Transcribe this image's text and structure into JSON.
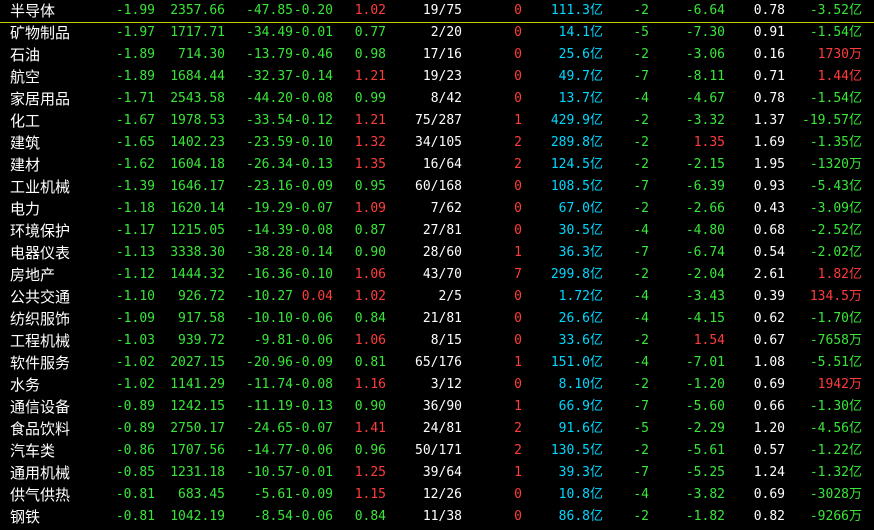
{
  "colors": {
    "up": "#ff3c3c",
    "down": "#39e639",
    "neutral": "#ffffff",
    "amount": "#00d8ff",
    "background": "#000000",
    "selection_line": "#c8c800"
  },
  "rows": [
    {
      "name": "半导体",
      "chg": "-1.99",
      "val": "2357.66",
      "amt": "-47.85",
      "ratio": "-0.20",
      "n1": "1.02",
      "n1c": "rd",
      "n2": "19/75",
      "n3": "0",
      "n3c": "rd",
      "n4": "111.3",
      "n4u": "亿",
      "n5": "-2",
      "n6": "-6.64",
      "n6c": "g",
      "n7": "0.78",
      "n8": "-3.52",
      "n8u": "亿",
      "n8c": "g"
    },
    {
      "name": "矿物制品",
      "chg": "-1.97",
      "val": "1717.71",
      "amt": "-34.49",
      "ratio": "-0.01",
      "n1": "0.77",
      "n1c": "g",
      "n2": "2/20",
      "n3": "0",
      "n3c": "rd",
      "n4": "14.1",
      "n4u": "亿",
      "n5": "-5",
      "n6": "-7.30",
      "n6c": "g",
      "n7": "0.91",
      "n8": "-1.54",
      "n8u": "亿",
      "n8c": "g"
    },
    {
      "name": "石油",
      "chg": "-1.89",
      "val": "714.30",
      "amt": "-13.79",
      "ratio": "-0.46",
      "n1": "0.98",
      "n1c": "g",
      "n2": "17/16",
      "n3": "0",
      "n3c": "rd",
      "n4": "25.6",
      "n4u": "亿",
      "n5": "-2",
      "n6": "-3.06",
      "n6c": "g",
      "n7": "0.16",
      "n8": "1730",
      "n8u": "万",
      "n8c": "rd"
    },
    {
      "name": "航空",
      "chg": "-1.89",
      "val": "1684.44",
      "amt": "-32.37",
      "ratio": "-0.14",
      "n1": "1.21",
      "n1c": "rd",
      "n2": "19/23",
      "n3": "0",
      "n3c": "rd",
      "n4": "49.7",
      "n4u": "亿",
      "n5": "-7",
      "n6": "-8.11",
      "n6c": "g",
      "n7": "0.71",
      "n8": "1.44",
      "n8u": "亿",
      "n8c": "rd"
    },
    {
      "name": "家居用品",
      "chg": "-1.71",
      "val": "2543.58",
      "amt": "-44.20",
      "ratio": "-0.08",
      "n1": "0.99",
      "n1c": "g",
      "n2": "8/42",
      "n3": "0",
      "n3c": "rd",
      "n4": "13.7",
      "n4u": "亿",
      "n5": "-4",
      "n6": "-4.67",
      "n6c": "g",
      "n7": "0.78",
      "n8": "-1.54",
      "n8u": "亿",
      "n8c": "g"
    },
    {
      "name": "化工",
      "chg": "-1.67",
      "val": "1978.53",
      "amt": "-33.54",
      "ratio": "-0.12",
      "n1": "1.21",
      "n1c": "rd",
      "n2": "75/287",
      "n3": "1",
      "n3c": "rd",
      "n4": "429.9",
      "n4u": "亿",
      "n5": "-2",
      "n6": "-3.32",
      "n6c": "g",
      "n7": "1.37",
      "n8": "-19.57",
      "n8u": "亿",
      "n8c": "g"
    },
    {
      "name": "建筑",
      "chg": "-1.65",
      "val": "1402.23",
      "amt": "-23.59",
      "ratio": "-0.10",
      "n1": "1.32",
      "n1c": "rd",
      "n2": "34/105",
      "n3": "2",
      "n3c": "rd",
      "n4": "289.8",
      "n4u": "亿",
      "n5": "-2",
      "n6": "1.35",
      "n6c": "rd",
      "n7": "1.69",
      "n8": "-1.35",
      "n8u": "亿",
      "n8c": "g"
    },
    {
      "name": "建材",
      "chg": "-1.62",
      "val": "1604.18",
      "amt": "-26.34",
      "ratio": "-0.13",
      "n1": "1.35",
      "n1c": "rd",
      "n2": "16/64",
      "n3": "2",
      "n3c": "rd",
      "n4": "124.5",
      "n4u": "亿",
      "n5": "-2",
      "n6": "-2.15",
      "n6c": "g",
      "n7": "1.95",
      "n8": "-1320",
      "n8u": "万",
      "n8c": "g"
    },
    {
      "name": "工业机械",
      "chg": "-1.39",
      "val": "1646.17",
      "amt": "-23.16",
      "ratio": "-0.09",
      "n1": "0.95",
      "n1c": "g",
      "n2": "60/168",
      "n3": "0",
      "n3c": "rd",
      "n4": "108.5",
      "n4u": "亿",
      "n5": "-7",
      "n6": "-6.39",
      "n6c": "g",
      "n7": "0.93",
      "n8": "-5.43",
      "n8u": "亿",
      "n8c": "g"
    },
    {
      "name": "电力",
      "chg": "-1.18",
      "val": "1620.14",
      "amt": "-19.29",
      "ratio": "-0.07",
      "n1": "1.09",
      "n1c": "rd",
      "n2": "7/62",
      "n3": "0",
      "n3c": "rd",
      "n4": "67.0",
      "n4u": "亿",
      "n5": "-2",
      "n6": "-2.66",
      "n6c": "g",
      "n7": "0.43",
      "n8": "-3.09",
      "n8u": "亿",
      "n8c": "g"
    },
    {
      "name": "环境保护",
      "chg": "-1.17",
      "val": "1215.05",
      "amt": "-14.39",
      "ratio": "-0.08",
      "n1": "0.87",
      "n1c": "g",
      "n2": "27/81",
      "n3": "0",
      "n3c": "rd",
      "n4": "30.5",
      "n4u": "亿",
      "n5": "-4",
      "n6": "-4.80",
      "n6c": "g",
      "n7": "0.68",
      "n8": "-2.52",
      "n8u": "亿",
      "n8c": "g"
    },
    {
      "name": "电器仪表",
      "chg": "-1.13",
      "val": "3338.30",
      "amt": "-38.28",
      "ratio": "-0.14",
      "n1": "0.90",
      "n1c": "g",
      "n2": "28/60",
      "n3": "1",
      "n3c": "rd",
      "n4": "36.3",
      "n4u": "亿",
      "n5": "-7",
      "n6": "-6.74",
      "n6c": "g",
      "n7": "0.54",
      "n8": "-2.02",
      "n8u": "亿",
      "n8c": "g"
    },
    {
      "name": "房地产",
      "chg": "-1.12",
      "val": "1444.32",
      "amt": "-16.36",
      "ratio": "-0.10",
      "n1": "1.06",
      "n1c": "rd",
      "n2": "43/70",
      "n3": "7",
      "n3c": "rd",
      "n4": "299.8",
      "n4u": "亿",
      "n5": "-2",
      "n6": "-2.04",
      "n6c": "g",
      "n7": "2.61",
      "n8": "1.82",
      "n8u": "亿",
      "n8c": "rd"
    },
    {
      "name": "公共交通",
      "chg": "-1.10",
      "val": "926.72",
      "amt": "-10.27",
      "ratio": "0.04",
      "ratioc": "rd",
      "n1": "1.02",
      "n1c": "rd",
      "n2": "2/5",
      "n3": "0",
      "n3c": "rd",
      "n4": "1.72",
      "n4u": "亿",
      "n5": "-4",
      "n6": "-3.43",
      "n6c": "g",
      "n7": "0.39",
      "n8": "134.5",
      "n8u": "万",
      "n8c": "rd"
    },
    {
      "name": "纺织服饰",
      "chg": "-1.09",
      "val": "917.58",
      "amt": "-10.10",
      "ratio": "-0.06",
      "n1": "0.84",
      "n1c": "g",
      "n2": "21/81",
      "n3": "0",
      "n3c": "rd",
      "n4": "26.6",
      "n4u": "亿",
      "n5": "-4",
      "n6": "-4.15",
      "n6c": "g",
      "n7": "0.62",
      "n8": "-1.70",
      "n8u": "亿",
      "n8c": "g"
    },
    {
      "name": "工程机械",
      "chg": "-1.03",
      "val": "939.72",
      "amt": "-9.81",
      "ratio": "-0.06",
      "n1": "1.06",
      "n1c": "rd",
      "n2": "8/15",
      "n3": "0",
      "n3c": "rd",
      "n4": "33.6",
      "n4u": "亿",
      "n5": "-2",
      "n6": "1.54",
      "n6c": "rd",
      "n7": "0.67",
      "n8": "-7658",
      "n8u": "万",
      "n8c": "g"
    },
    {
      "name": "软件服务",
      "chg": "-1.02",
      "val": "2027.15",
      "amt": "-20.96",
      "ratio": "-0.09",
      "n1": "0.81",
      "n1c": "g",
      "n2": "65/176",
      "n3": "1",
      "n3c": "rd",
      "n4": "151.0",
      "n4u": "亿",
      "n5": "-4",
      "n6": "-7.01",
      "n6c": "g",
      "n7": "1.08",
      "n8": "-5.51",
      "n8u": "亿",
      "n8c": "g"
    },
    {
      "name": "水务",
      "chg": "-1.02",
      "val": "1141.29",
      "amt": "-11.74",
      "ratio": "-0.08",
      "n1": "1.16",
      "n1c": "rd",
      "n2": "3/12",
      "n3": "0",
      "n3c": "rd",
      "n4": "8.10",
      "n4u": "亿",
      "n5": "-2",
      "n6": "-1.20",
      "n6c": "g",
      "n7": "0.69",
      "n8": "1942",
      "n8u": "万",
      "n8c": "rd"
    },
    {
      "name": "通信设备",
      "chg": "-0.89",
      "val": "1242.15",
      "amt": "-11.19",
      "ratio": "-0.13",
      "n1": "0.90",
      "n1c": "g",
      "n2": "36/90",
      "n3": "1",
      "n3c": "rd",
      "n4": "66.9",
      "n4u": "亿",
      "n5": "-7",
      "n6": "-5.60",
      "n6c": "g",
      "n7": "0.66",
      "n8": "-1.30",
      "n8u": "亿",
      "n8c": "g"
    },
    {
      "name": "食品饮料",
      "chg": "-0.89",
      "val": "2750.17",
      "amt": "-24.65",
      "ratio": "-0.07",
      "n1": "1.41",
      "n1c": "rd",
      "n2": "24/81",
      "n3": "2",
      "n3c": "rd",
      "n4": "91.6",
      "n4u": "亿",
      "n5": "-5",
      "n6": "-2.29",
      "n6c": "g",
      "n7": "1.20",
      "n8": "-4.56",
      "n8u": "亿",
      "n8c": "g"
    },
    {
      "name": "汽车类",
      "chg": "-0.86",
      "val": "1707.56",
      "amt": "-14.77",
      "ratio": "-0.06",
      "n1": "0.96",
      "n1c": "g",
      "n2": "50/171",
      "n3": "2",
      "n3c": "rd",
      "n4": "130.5",
      "n4u": "亿",
      "n5": "-2",
      "n6": "-5.61",
      "n6c": "g",
      "n7": "0.57",
      "n8": "-1.22",
      "n8u": "亿",
      "n8c": "g"
    },
    {
      "name": "通用机械",
      "chg": "-0.85",
      "val": "1231.18",
      "amt": "-10.57",
      "ratio": "-0.01",
      "n1": "1.25",
      "n1c": "rd",
      "n2": "39/64",
      "n3": "1",
      "n3c": "rd",
      "n4": "39.3",
      "n4u": "亿",
      "n5": "-7",
      "n6": "-5.25",
      "n6c": "g",
      "n7": "1.24",
      "n8": "-1.32",
      "n8u": "亿",
      "n8c": "g"
    },
    {
      "name": "供气供热",
      "chg": "-0.81",
      "val": "683.45",
      "amt": "-5.61",
      "ratio": "-0.09",
      "n1": "1.15",
      "n1c": "rd",
      "n2": "12/26",
      "n3": "0",
      "n3c": "rd",
      "n4": "10.8",
      "n4u": "亿",
      "n5": "-4",
      "n6": "-3.82",
      "n6c": "g",
      "n7": "0.69",
      "n8": "-3028",
      "n8u": "万",
      "n8c": "g"
    },
    {
      "name": "钢铁",
      "chg": "-0.81",
      "val": "1042.19",
      "amt": "-8.54",
      "ratio": "-0.06",
      "n1": "0.84",
      "n1c": "g",
      "n2": "11/38",
      "n3": "0",
      "n3c": "rd",
      "n4": "86.8",
      "n4u": "亿",
      "n5": "-2",
      "n6": "-1.82",
      "n6c": "g",
      "n7": "0.82",
      "n8": "-9266",
      "n8u": "万",
      "n8c": "g"
    }
  ]
}
